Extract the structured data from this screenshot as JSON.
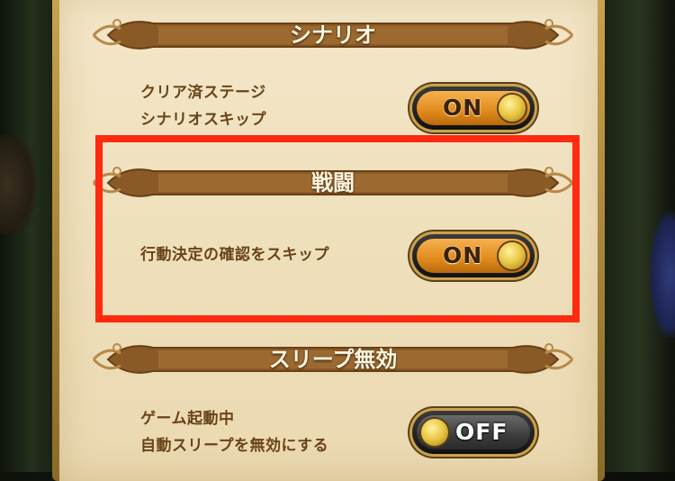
{
  "sections": [
    {
      "title": "シナリオ",
      "items": [
        {
          "label_lines": [
            "クリア済ステージ",
            "シナリオスキップ"
          ],
          "toggle": "ON"
        }
      ]
    },
    {
      "title": "戦闘",
      "items": [
        {
          "label_lines": [
            "行動決定の確認をスキップ"
          ],
          "toggle": "ON"
        }
      ]
    },
    {
      "title": "スリープ無効",
      "items": [
        {
          "label_lines": [
            "ゲーム起動中",
            "自動スリープを無効にする"
          ],
          "toggle": "OFF"
        }
      ]
    }
  ],
  "colors": {
    "highlight": "#ff2a10",
    "banner": "#8a5a26",
    "panel": "#f3e7c9",
    "toggle_on": "#e08a1c",
    "toggle_off": "#3c3c3c"
  }
}
